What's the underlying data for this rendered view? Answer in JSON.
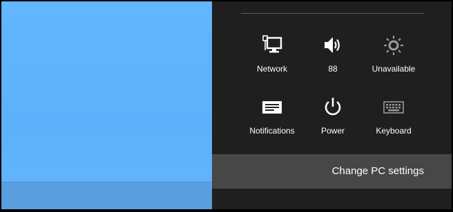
{
  "settings": {
    "tiles": [
      {
        "label": "Network",
        "icon": "network-icon"
      },
      {
        "label": "88",
        "icon": "volume-icon"
      },
      {
        "label": "Unavailable",
        "icon": "brightness-icon"
      },
      {
        "label": "Notifications",
        "icon": "notifications-icon"
      },
      {
        "label": "Power",
        "icon": "power-icon"
      },
      {
        "label": "Keyboard",
        "icon": "keyboard-icon"
      }
    ],
    "change_pc_settings": "Change PC settings"
  },
  "colors": {
    "charm_background": "#1f1f1f",
    "desktop_background": "#62b6fd",
    "change_settings_background": "#474747"
  }
}
